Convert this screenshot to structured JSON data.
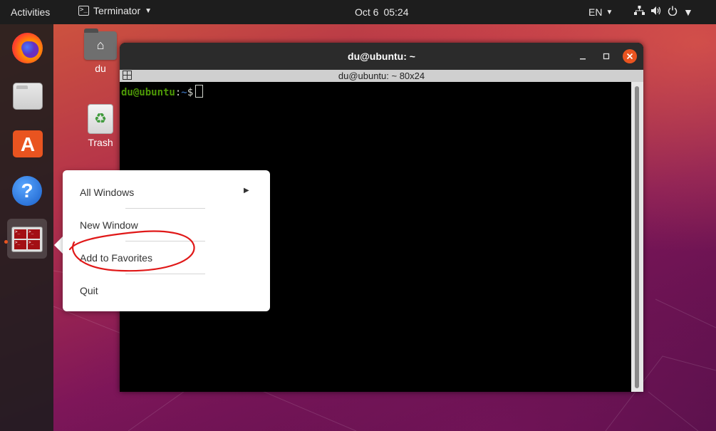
{
  "topbar": {
    "activities": "Activities",
    "app_name": "Terminator",
    "date": "Oct 6",
    "time": "05:24",
    "language": "EN"
  },
  "dock": {
    "items": [
      {
        "name": "Firefox",
        "icon": "firefox-icon"
      },
      {
        "name": "Files",
        "icon": "files-icon"
      },
      {
        "name": "Ubuntu Software",
        "icon": "software-store-icon"
      },
      {
        "name": "Help",
        "icon": "help-icon"
      },
      {
        "name": "Terminator",
        "icon": "terminator-icon",
        "running": true
      }
    ]
  },
  "desktop": {
    "icons": [
      {
        "label": "du",
        "icon": "home-folder-icon"
      },
      {
        "label": "Trash",
        "icon": "trash-icon"
      }
    ]
  },
  "terminal": {
    "title": "du@ubuntu: ~",
    "subtitle": "du@ubuntu: ~ 80x24",
    "prompt_user": "du@ubuntu",
    "prompt_colon": ":",
    "prompt_path": "~",
    "prompt_symbol": "$"
  },
  "context_menu": {
    "all_windows": "All Windows",
    "new_window": "New Window",
    "add_to_favorites": "Add to Favorites",
    "quit": "Quit"
  },
  "colors": {
    "accent": "#e95420",
    "annotation": "#e01818",
    "topbar_bg": "#1d1d1d"
  }
}
